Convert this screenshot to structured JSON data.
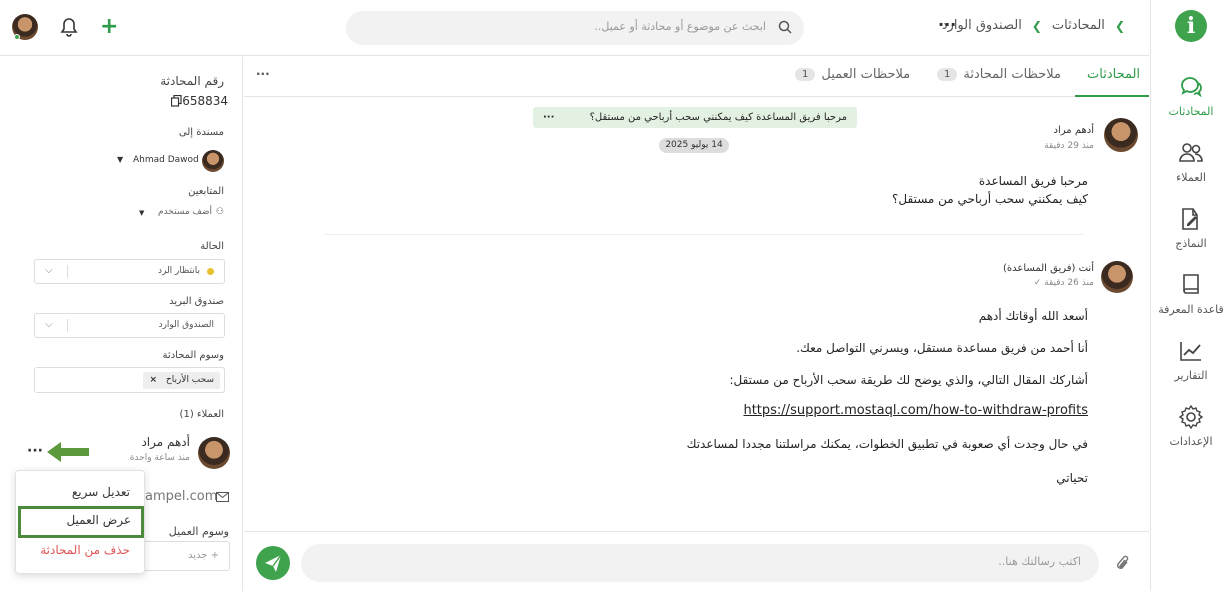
{
  "nav": {
    "items": [
      {
        "label": "المحادثات",
        "icon": "chat-icon"
      },
      {
        "label": "العملاء",
        "icon": "users-icon"
      },
      {
        "label": "النماذج",
        "icon": "form-edit-icon"
      },
      {
        "label": "قاعدة المعرفة",
        "icon": "book-icon"
      },
      {
        "label": "التقارير",
        "icon": "chart-icon"
      },
      {
        "label": "الإعدادات",
        "icon": "gear-icon"
      }
    ],
    "accent": "#2e9c4a"
  },
  "topbar": {
    "breadcrumb": [
      "المحادثات",
      "الصندوق الوارد"
    ],
    "search_placeholder": "ابحث عن موضوع أو محادثة أو عميل.."
  },
  "tabs": [
    {
      "label": "المحادثات",
      "badge": ""
    },
    {
      "label": "ملاحظات المحادثة",
      "badge": "1"
    },
    {
      "label": "ملاحظات العميل",
      "badge": "1"
    }
  ],
  "info": {
    "conv_number_label": "رقم المحادثة",
    "conv_number": "658834",
    "assigned_label": "مسندة إلى",
    "assigned_name": "Ahmad Dawod",
    "followers_label": "المتابعين",
    "add_user": "أضف مستخدم",
    "status_label": "الحالة",
    "status_value": "بانتظار الرد",
    "mailbox_label": "صندوق البريد",
    "mailbox_value": "الصندوق الوارد",
    "tags_label": "وسوم المحادثة",
    "tag_value": "سحب الأرباح",
    "customers_label": "العملاء (1)",
    "customer_name": "أدهم مراد",
    "customer_time": "منذ ساعة واحدة",
    "email_partial": "ampel.com",
    "customer_tags_label": "وسوم العميل",
    "new_tag_placeholder": "+ جديد"
  },
  "menu": {
    "items": [
      "تعديل سريع",
      "عرض العميل",
      "حذف من المحادثة"
    ]
  },
  "chat": {
    "pinned": "مرحبا فريق المساعدة كيف يمكنني سحب أرباحي من مستقل؟",
    "date": "14 يوليو 2025",
    "msg1": {
      "name": "أدهم مراد",
      "time": "منذ 29 دقيقة",
      "lines": [
        "مرحبا فريق المساعدة",
        "كيف يمكنني سحب أرباحي من مستقل؟"
      ]
    },
    "msg2": {
      "name": "أنت (فريق المساعدة)",
      "time": "منذ 26 دقيقة ✓",
      "lines": [
        "أسعد الله أوقاتك أدهم",
        "أنا أحمد من فريق مساعدة مستقل، ويسرني التواصل معك.",
        "أشاركك المقال التالي، والذي يوضح لك طريقة سحب الأرباح من مستقل:",
        "https://support.mostaql.com/how-to-withdraw-profits",
        "في حال وجدت أي صعوبة في تطبيق الخطوات، يمكنك مراسلتنا مجددا لمساعدتك",
        "تحياتي"
      ]
    },
    "composer_placeholder": "اكتب رسالتك هنا.."
  }
}
